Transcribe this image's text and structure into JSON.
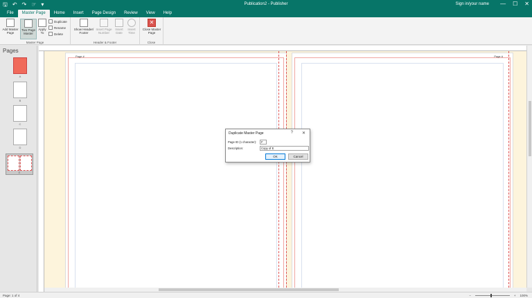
{
  "titlebar": {
    "title": "Publication2 - Publisher",
    "user": "Sign in/your name",
    "qat": [
      "save-icon",
      "undo-icon",
      "redo-icon",
      "touch-icon",
      "customize-icon"
    ],
    "qat_glyphs": [
      "🖫",
      "↶",
      "↷",
      "☞",
      "▾"
    ]
  },
  "tabs": [
    "File",
    "Master Page",
    "Home",
    "Insert",
    "Page Design",
    "Review",
    "View",
    "Help"
  ],
  "active_tab": "Master Page",
  "ribbon": {
    "master_page": {
      "label": "Master Page",
      "add": "Add Master Page",
      "two_page": "Two Page Master",
      "apply": "Apply To",
      "duplicate": "Duplicate",
      "rename": "Rename",
      "delete": "Delete"
    },
    "header_footer": {
      "label": "Header & Footer",
      "show": "Show Header/ Footer",
      "insert_number": "Insert Page Number",
      "insert_date": "Insert Date",
      "insert_time": "Insert Time"
    },
    "close": {
      "label": "Close",
      "close_master": "Close Master Page",
      "glyph": "✕"
    }
  },
  "pages_pane": {
    "title": "Pages",
    "thumbs": [
      {
        "label": "A"
      },
      {
        "label": "B"
      },
      {
        "label": "C"
      },
      {
        "label": "D"
      },
      {
        "label": "E"
      }
    ]
  },
  "pages": {
    "left_header": "Page #",
    "right_header": "Page #"
  },
  "dialog": {
    "title": "Duplicate Master Page",
    "help": "?",
    "close": "✕",
    "page_id_label": "Page ID (1 character):",
    "page_id_value": "F",
    "description_label": "Description:",
    "description_value": "Copy of E",
    "ok": "OK",
    "cancel": "Cancel"
  },
  "status": {
    "page": "Page: 1 of 4",
    "zoom": "100%"
  },
  "colors": {
    "accent": "#077568",
    "workspace": "#fdf4dc",
    "guide": "#e05555"
  }
}
